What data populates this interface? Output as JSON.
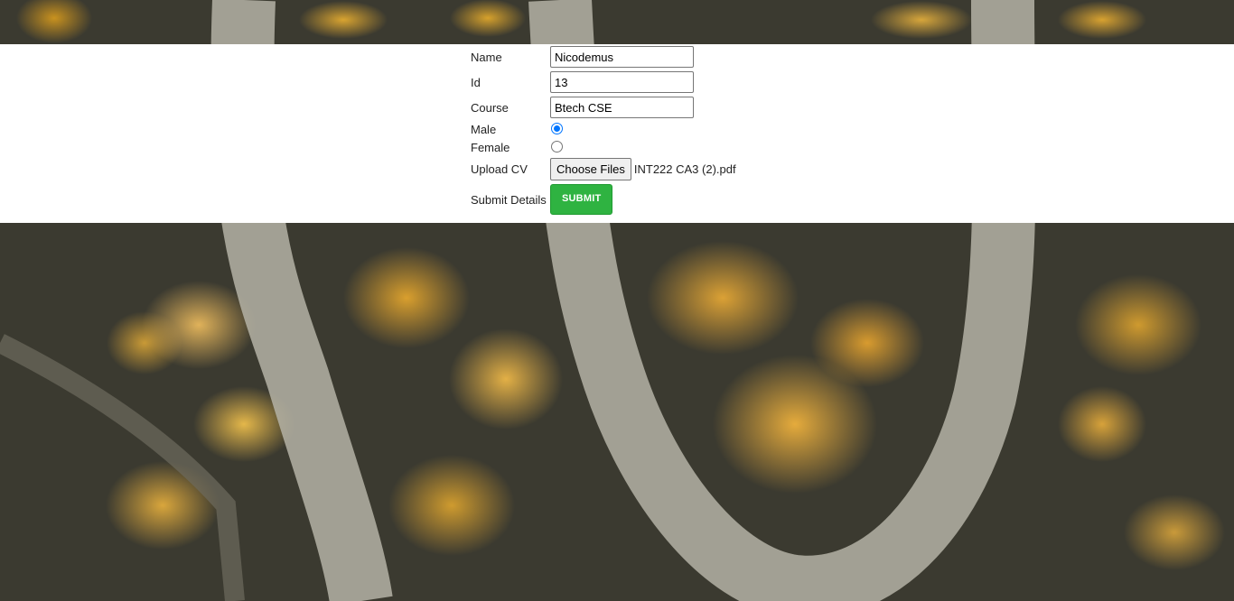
{
  "form": {
    "name_label": "Name",
    "name_value": "Nicodemus",
    "id_label": "Id",
    "id_value": "13",
    "course_label": "Course",
    "course_value": "Btech CSE",
    "male_label": "Male",
    "female_label": "Female",
    "gender_selected": "Male",
    "upload_label": "Upload CV",
    "choose_files_label": "Choose Files",
    "file_name": "INT222 CA3 (2).pdf",
    "submit_details_label": "Submit Details",
    "submit_label": "SUBMIT"
  },
  "colors": {
    "submit_button": "#2fb341",
    "radio_selected": "#0075ff",
    "form_band": "#ffffff"
  }
}
